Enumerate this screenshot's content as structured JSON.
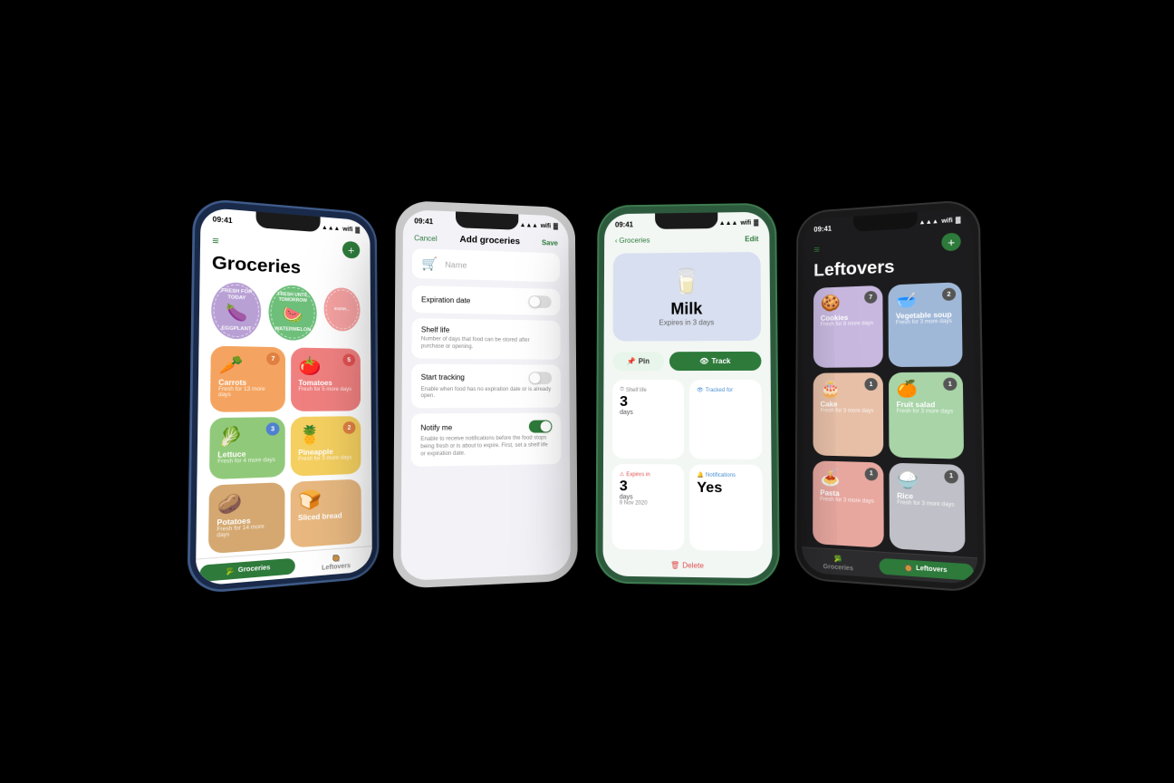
{
  "phones": [
    {
      "id": "phone-1",
      "type": "groceries",
      "time": "09:41",
      "title": "Groceries",
      "circles": [
        {
          "label": "FRESH FOR TODAY",
          "sublabel": "EGGPLANT",
          "emoji": "🍆",
          "bg": "purple"
        },
        {
          "label": "FRESH UNTIL TOMORROW",
          "sublabel": "WATERMELON",
          "emoji": "🍉",
          "bg": "green"
        }
      ],
      "items": [
        {
          "name": "Carrots",
          "sub": "Fresh for 13 more days",
          "emoji": "🥕",
          "badge": "7",
          "badgeColor": "orange",
          "bg": "orange"
        },
        {
          "name": "Tomatoes",
          "sub": "Fresh for 5 more days",
          "emoji": "🍅",
          "badge": "5",
          "badgeColor": "red",
          "bg": "red"
        },
        {
          "name": "Lettuce",
          "sub": "Fresh for 4 more days",
          "emoji": "🥬",
          "badge": "3",
          "badgeColor": "blue",
          "bg": "green"
        },
        {
          "name": "Pineapple",
          "sub": "Fresh for 3 more days",
          "emoji": "🍍",
          "badge": "2",
          "badgeColor": "orange",
          "bg": "yellow"
        },
        {
          "name": "Potatoes",
          "sub": "Fresh for 14 more days",
          "emoji": "🥔",
          "badge": "",
          "bg": "brown"
        },
        {
          "name": "Sliced bread",
          "sub": "",
          "emoji": "🍞",
          "badge": "",
          "bg": "orange"
        }
      ],
      "tabs": [
        {
          "label": "Groceries",
          "active": true,
          "emoji": "🥦"
        },
        {
          "label": "Leftovers",
          "active": false,
          "emoji": "🥘"
        }
      ]
    },
    {
      "id": "phone-2",
      "type": "add-groceries",
      "time": "09:41",
      "title": "Add groceries",
      "cancel": "Cancel",
      "save": "Save",
      "fields": [
        {
          "label": "Name",
          "type": "input",
          "placeholder": "Name"
        },
        {
          "label": "Expiration date",
          "type": "toggle",
          "desc": "",
          "value": false
        },
        {
          "label": "Shelf life",
          "type": "none",
          "desc": "Number of days that food can be stored after purchase or opening."
        },
        {
          "label": "Start tracking",
          "type": "toggle",
          "desc": "Enable when food has no expiration date or is already open.",
          "value": false
        },
        {
          "label": "Notify me",
          "type": "toggle",
          "desc": "Enable to receive notifications before the food stops being fresh or is about to expire. First, set a shelf life or expiration date.",
          "value": true
        }
      ]
    },
    {
      "id": "phone-3",
      "type": "detail",
      "time": "09:41",
      "back": "Groceries",
      "edit": "Edit",
      "hero": {
        "emoji": "🥛",
        "name": "Milk",
        "sub": "Expires in 3 days"
      },
      "actions": [
        {
          "label": "Pin",
          "type": "pin"
        },
        {
          "label": "Track",
          "type": "track"
        }
      ],
      "stats": [
        {
          "label": "Shelf life",
          "icon": "⏱",
          "value": "3",
          "unit": "days",
          "color": "normal"
        },
        {
          "label": "Tracked for",
          "icon": "👁",
          "value": "",
          "unit": "",
          "color": "blue"
        },
        {
          "label": "Expires in",
          "icon": "⚠",
          "value": "3",
          "unit": "days",
          "date": "9 Nov 2020",
          "color": "red"
        },
        {
          "label": "Notifications",
          "icon": "🔔",
          "value": "Yes",
          "unit": "",
          "color": "blue"
        }
      ],
      "delete": "Delete"
    },
    {
      "id": "phone-4",
      "type": "leftovers",
      "time": "09:41",
      "title": "Leftovers",
      "items": [
        {
          "name": "Cookies",
          "sub": "Fresh for 8 more days",
          "emoji": "🍪",
          "badge": "7",
          "bg": "purple"
        },
        {
          "name": "Vegetable soup",
          "sub": "Fresh for 3 more days",
          "emoji": "🥣",
          "badge": "2",
          "bg": "blue"
        },
        {
          "name": "Cake",
          "sub": "Fresh for 3 more days",
          "emoji": "🎂",
          "badge": "1",
          "bg": "pink"
        },
        {
          "name": "Fruit salad",
          "sub": "Fresh for 3 more days",
          "emoji": "🍊",
          "badge": "1",
          "bg": "green"
        },
        {
          "name": "Pasta",
          "sub": "Fresh for 3 more days",
          "emoji": "🍝",
          "badge": "1",
          "bg": "red"
        },
        {
          "name": "Rice",
          "sub": "Fresh for 3 more days",
          "emoji": "⚪",
          "badge": "1",
          "bg": "gray"
        }
      ],
      "tabs": [
        {
          "label": "Groceries",
          "active": false,
          "emoji": "🥦"
        },
        {
          "label": "Leftovers",
          "active": true,
          "emoji": "🥘"
        }
      ]
    }
  ]
}
